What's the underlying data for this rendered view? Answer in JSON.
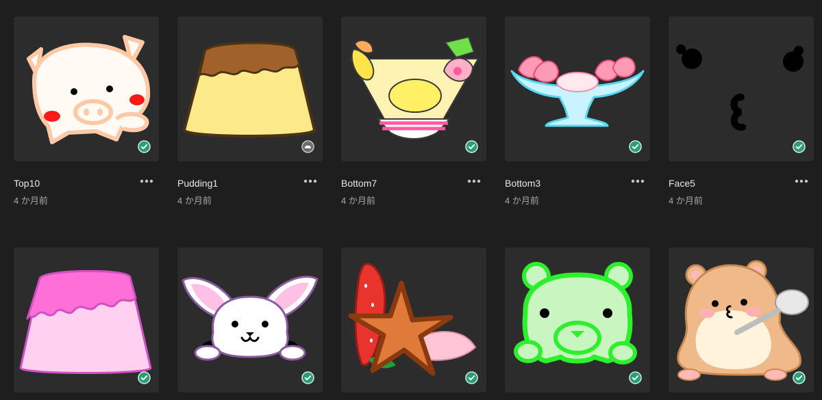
{
  "items": [
    {
      "name": "Top10",
      "date": "4 か月前",
      "status": "synced",
      "art": "pig-icon"
    },
    {
      "name": "Pudding1",
      "date": "4 か月前",
      "status": "cloud",
      "art": "pudding-icon"
    },
    {
      "name": "Bottom7",
      "date": "4 か月前",
      "status": "synced",
      "art": "fruit-parfait-icon"
    },
    {
      "name": "Bottom3",
      "date": "4 か月前",
      "status": "synced",
      "art": "strawberry-sundae-icon"
    },
    {
      "name": "Face5",
      "date": "4 か月前",
      "status": "synced",
      "art": "face-icon"
    },
    {
      "name": "",
      "date": "",
      "status": "synced",
      "art": "pink-pudding-icon"
    },
    {
      "name": "",
      "date": "",
      "status": "synced",
      "art": "bunny-icon"
    },
    {
      "name": "",
      "date": "",
      "status": "synced",
      "art": "star-strawberry-icon"
    },
    {
      "name": "",
      "date": "",
      "status": "synced",
      "art": "green-bear-icon"
    },
    {
      "name": "",
      "date": "",
      "status": "synced",
      "art": "hamster-icon"
    }
  ],
  "colors": {
    "background": "#1e1e1e",
    "card": "#2c2c2c",
    "synced": "#2d9d78",
    "cloud": "#6e6e6e"
  }
}
